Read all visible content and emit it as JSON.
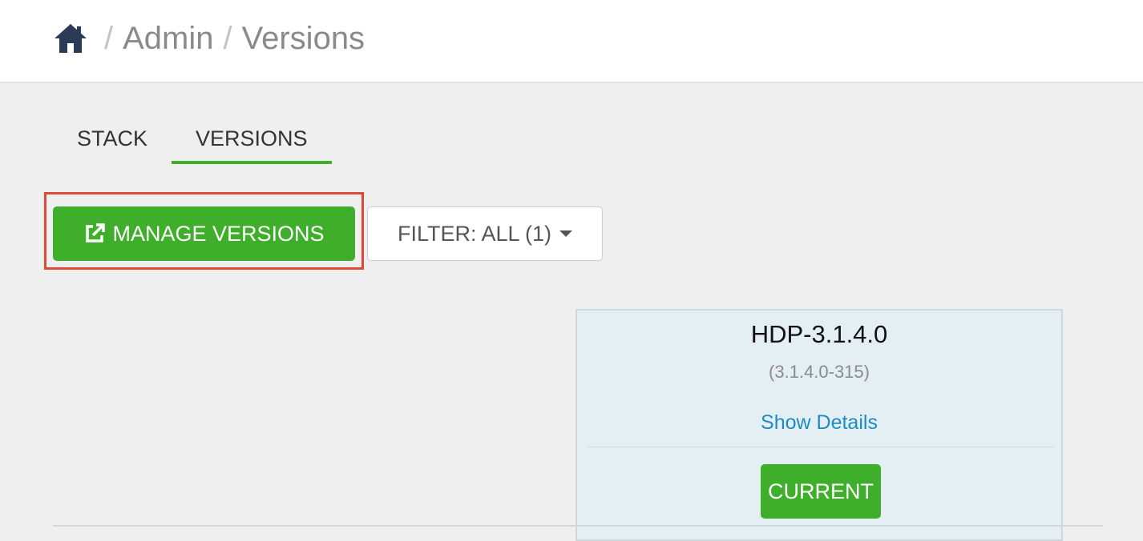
{
  "breadcrumb": {
    "home_icon": "home-icon",
    "separator": "/",
    "items": [
      "Admin",
      "Versions"
    ]
  },
  "tabs": [
    {
      "label": "STACK",
      "active": false
    },
    {
      "label": "VERSIONS",
      "active": true
    }
  ],
  "toolbar": {
    "manage_label": "MANAGE VERSIONS",
    "manage_icon": "external-link-icon",
    "filter_label": "FILTER: ALL (1)"
  },
  "version_card": {
    "name": "HDP-3.1.4.0",
    "build": "(3.1.4.0-315)",
    "details_link": "Show Details",
    "status_label": "CURRENT"
  },
  "colors": {
    "accent_green": "#3fae2a",
    "link_blue": "#1e8bc3",
    "highlight_red": "#e04a34",
    "card_bg": "#e4eff4"
  }
}
